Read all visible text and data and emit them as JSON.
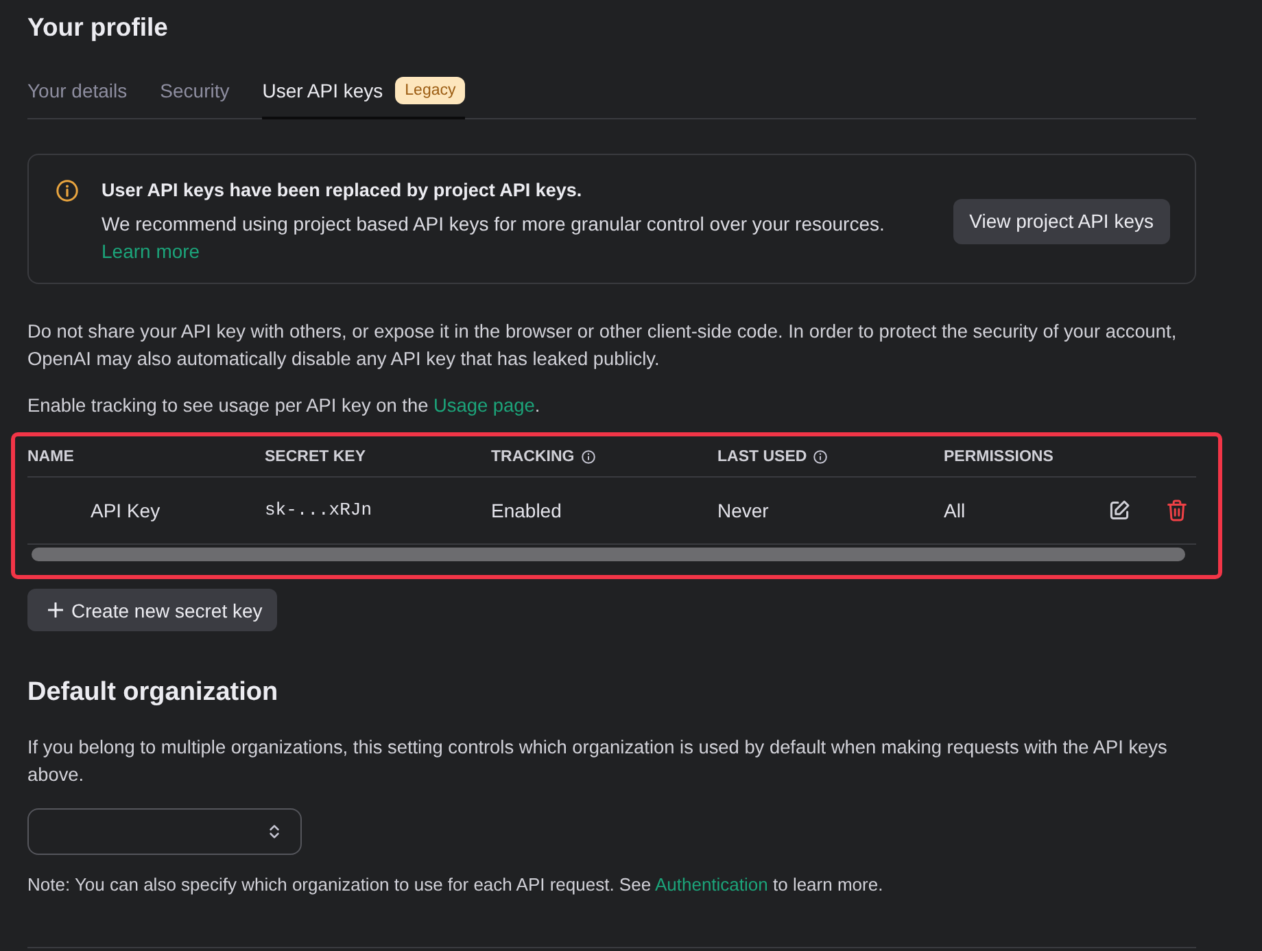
{
  "page": {
    "title": "Your profile"
  },
  "tabs": [
    {
      "label": "Your details",
      "selected": false
    },
    {
      "label": "Security",
      "selected": false
    },
    {
      "label": "User API keys",
      "selected": true,
      "badge": "Legacy"
    }
  ],
  "notice": {
    "title": "User API keys have been replaced by project API keys.",
    "text": "We recommend using project based API keys for more granular control over your resources.",
    "link": "Learn more",
    "button": "View project API keys"
  },
  "warning_text": "Do not share your API key with others, or expose it in the browser or other client-side code. In order to protect the security of your account, OpenAI may also automatically disable any API key that has leaked publicly.",
  "tracking_hint": {
    "text": "Enable tracking to see usage per API key on the",
    "link": "Usage page",
    "suffix": "."
  },
  "keys_table": {
    "highlighted": true,
    "columns": [
      {
        "label": "NAME",
        "info_icon": false
      },
      {
        "label": "SECRET KEY",
        "info_icon": false
      },
      {
        "label": "TRACKING",
        "info_icon": true
      },
      {
        "label": "LAST USED",
        "info_icon": true
      },
      {
        "label": "PERMISSIONS",
        "info_icon": false
      }
    ],
    "rows": [
      {
        "name": "API Key",
        "secret_key": "sk-...xRJn",
        "tracking": "Enabled",
        "last_used": "Never",
        "permissions": "All"
      }
    ]
  },
  "create_button": "Create new secret key",
  "default_organization": {
    "title": "Default organization",
    "description": "If you belong to multiple organizations, this setting controls which organization is used by default when making requests with the API keys above.",
    "note": {
      "text": "Note: You can also specify which organization to use for each API request. See",
      "link": "Authentication",
      "suffix": "to learn more."
    }
  }
}
